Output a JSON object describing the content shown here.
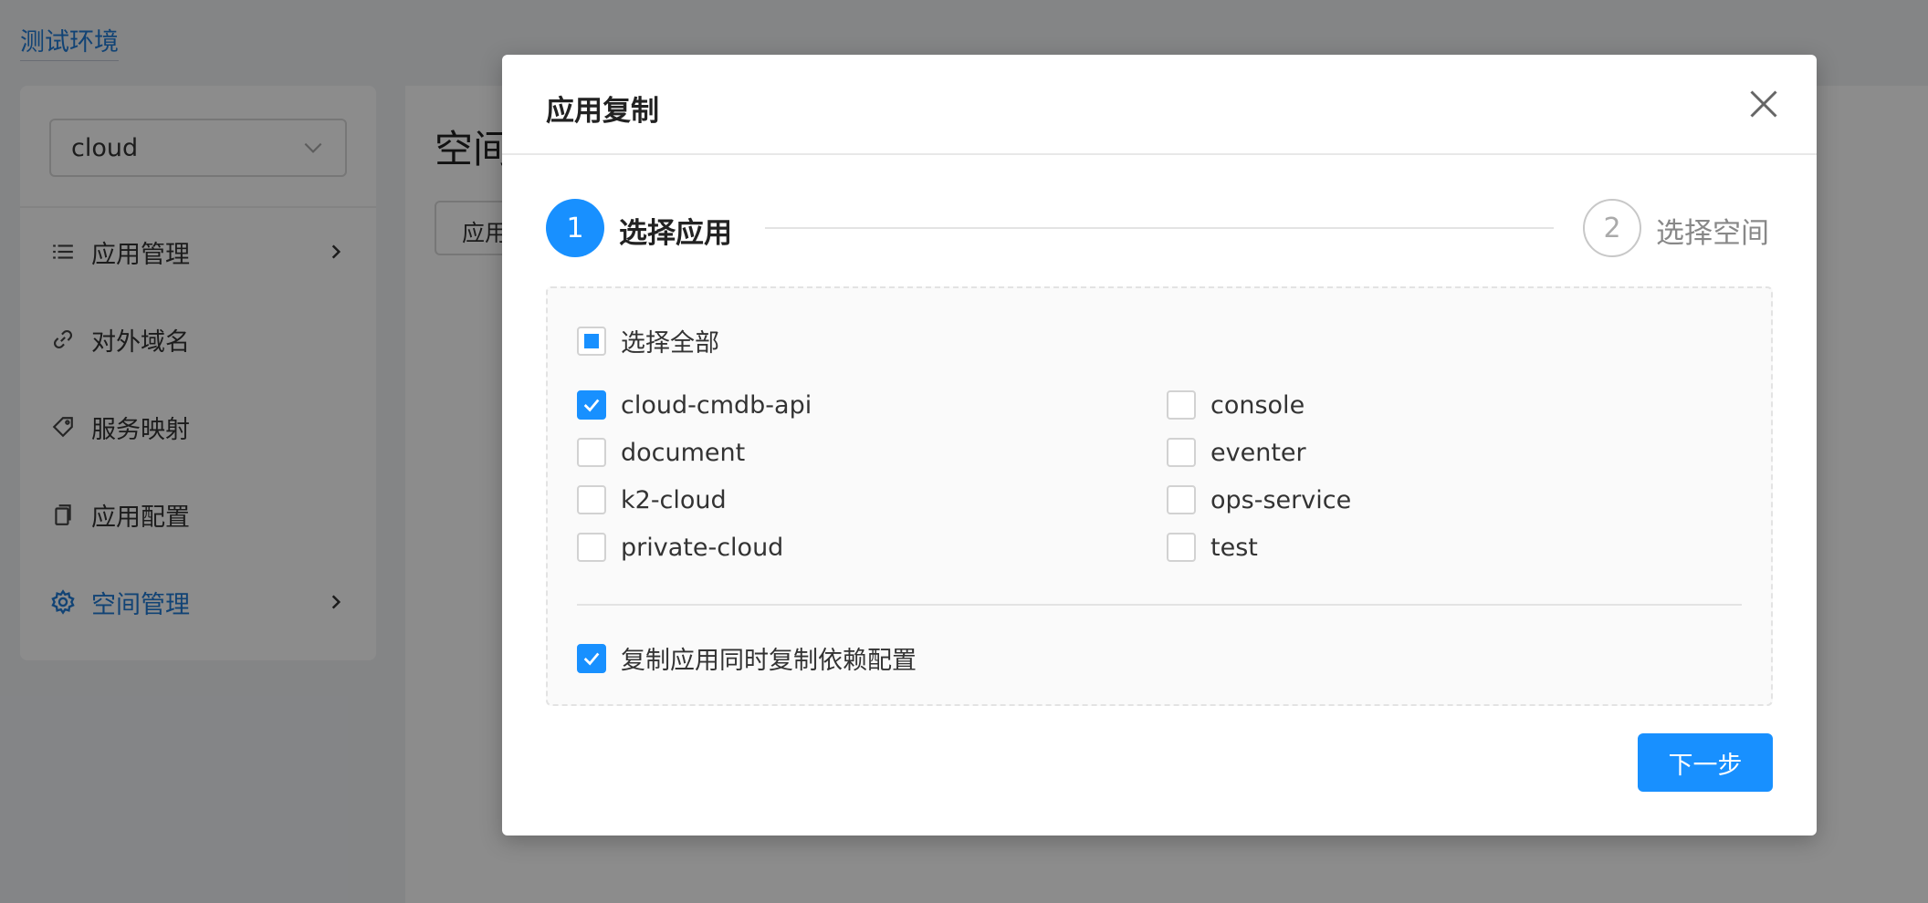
{
  "env": {
    "label": "测试环境"
  },
  "sidebar": {
    "select_value": "cloud",
    "items": [
      {
        "label": "应用管理",
        "icon": "list-icon",
        "has_arrow": true
      },
      {
        "label": "对外域名",
        "icon": "link-icon",
        "has_arrow": false
      },
      {
        "label": "服务映射",
        "icon": "tag-icon",
        "has_arrow": false
      },
      {
        "label": "应用配置",
        "icon": "copy-icon",
        "has_arrow": false
      },
      {
        "label": "空间管理",
        "icon": "gear-icon",
        "has_arrow": true,
        "active": true
      }
    ]
  },
  "content": {
    "title": "空间",
    "button_label": "应用"
  },
  "modal": {
    "title": "应用复制",
    "steps": [
      {
        "number": "1",
        "label": "选择应用",
        "status": "active"
      },
      {
        "number": "2",
        "label": "选择空间",
        "status": "pending"
      }
    ],
    "select_all_label": "选择全部",
    "apps": [
      {
        "label": "cloud-cmdb-api",
        "checked": true
      },
      {
        "label": "console",
        "checked": false
      },
      {
        "label": "document",
        "checked": false
      },
      {
        "label": "eventer",
        "checked": false
      },
      {
        "label": "k2-cloud",
        "checked": false
      },
      {
        "label": "ops-service",
        "checked": false
      },
      {
        "label": "private-cloud",
        "checked": false
      },
      {
        "label": "test",
        "checked": false
      }
    ],
    "copy_deps_label": "复制应用同时复制依赖配置",
    "copy_deps_checked": true,
    "next_label": "下一步"
  },
  "colors": {
    "primary": "#1890ff",
    "link": "#1f7ad6"
  }
}
